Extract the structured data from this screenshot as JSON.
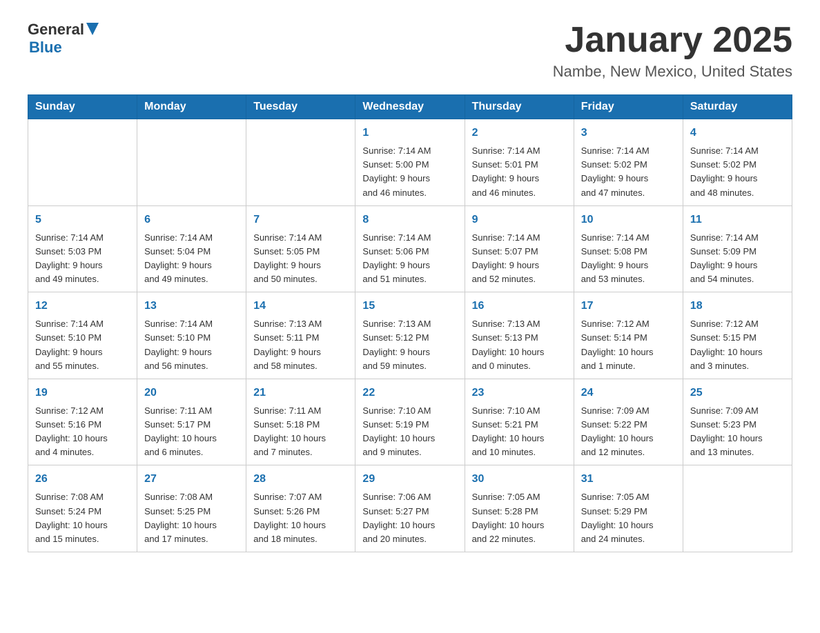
{
  "header": {
    "logo_general": "General",
    "logo_blue": "Blue",
    "title": "January 2025",
    "subtitle": "Nambe, New Mexico, United States"
  },
  "weekdays": [
    "Sunday",
    "Monday",
    "Tuesday",
    "Wednesday",
    "Thursday",
    "Friday",
    "Saturday"
  ],
  "weeks": [
    [
      {
        "day": "",
        "info": ""
      },
      {
        "day": "",
        "info": ""
      },
      {
        "day": "",
        "info": ""
      },
      {
        "day": "1",
        "info": "Sunrise: 7:14 AM\nSunset: 5:00 PM\nDaylight: 9 hours\nand 46 minutes."
      },
      {
        "day": "2",
        "info": "Sunrise: 7:14 AM\nSunset: 5:01 PM\nDaylight: 9 hours\nand 46 minutes."
      },
      {
        "day": "3",
        "info": "Sunrise: 7:14 AM\nSunset: 5:02 PM\nDaylight: 9 hours\nand 47 minutes."
      },
      {
        "day": "4",
        "info": "Sunrise: 7:14 AM\nSunset: 5:02 PM\nDaylight: 9 hours\nand 48 minutes."
      }
    ],
    [
      {
        "day": "5",
        "info": "Sunrise: 7:14 AM\nSunset: 5:03 PM\nDaylight: 9 hours\nand 49 minutes."
      },
      {
        "day": "6",
        "info": "Sunrise: 7:14 AM\nSunset: 5:04 PM\nDaylight: 9 hours\nand 49 minutes."
      },
      {
        "day": "7",
        "info": "Sunrise: 7:14 AM\nSunset: 5:05 PM\nDaylight: 9 hours\nand 50 minutes."
      },
      {
        "day": "8",
        "info": "Sunrise: 7:14 AM\nSunset: 5:06 PM\nDaylight: 9 hours\nand 51 minutes."
      },
      {
        "day": "9",
        "info": "Sunrise: 7:14 AM\nSunset: 5:07 PM\nDaylight: 9 hours\nand 52 minutes."
      },
      {
        "day": "10",
        "info": "Sunrise: 7:14 AM\nSunset: 5:08 PM\nDaylight: 9 hours\nand 53 minutes."
      },
      {
        "day": "11",
        "info": "Sunrise: 7:14 AM\nSunset: 5:09 PM\nDaylight: 9 hours\nand 54 minutes."
      }
    ],
    [
      {
        "day": "12",
        "info": "Sunrise: 7:14 AM\nSunset: 5:10 PM\nDaylight: 9 hours\nand 55 minutes."
      },
      {
        "day": "13",
        "info": "Sunrise: 7:14 AM\nSunset: 5:10 PM\nDaylight: 9 hours\nand 56 minutes."
      },
      {
        "day": "14",
        "info": "Sunrise: 7:13 AM\nSunset: 5:11 PM\nDaylight: 9 hours\nand 58 minutes."
      },
      {
        "day": "15",
        "info": "Sunrise: 7:13 AM\nSunset: 5:12 PM\nDaylight: 9 hours\nand 59 minutes."
      },
      {
        "day": "16",
        "info": "Sunrise: 7:13 AM\nSunset: 5:13 PM\nDaylight: 10 hours\nand 0 minutes."
      },
      {
        "day": "17",
        "info": "Sunrise: 7:12 AM\nSunset: 5:14 PM\nDaylight: 10 hours\nand 1 minute."
      },
      {
        "day": "18",
        "info": "Sunrise: 7:12 AM\nSunset: 5:15 PM\nDaylight: 10 hours\nand 3 minutes."
      }
    ],
    [
      {
        "day": "19",
        "info": "Sunrise: 7:12 AM\nSunset: 5:16 PM\nDaylight: 10 hours\nand 4 minutes."
      },
      {
        "day": "20",
        "info": "Sunrise: 7:11 AM\nSunset: 5:17 PM\nDaylight: 10 hours\nand 6 minutes."
      },
      {
        "day": "21",
        "info": "Sunrise: 7:11 AM\nSunset: 5:18 PM\nDaylight: 10 hours\nand 7 minutes."
      },
      {
        "day": "22",
        "info": "Sunrise: 7:10 AM\nSunset: 5:19 PM\nDaylight: 10 hours\nand 9 minutes."
      },
      {
        "day": "23",
        "info": "Sunrise: 7:10 AM\nSunset: 5:21 PM\nDaylight: 10 hours\nand 10 minutes."
      },
      {
        "day": "24",
        "info": "Sunrise: 7:09 AM\nSunset: 5:22 PM\nDaylight: 10 hours\nand 12 minutes."
      },
      {
        "day": "25",
        "info": "Sunrise: 7:09 AM\nSunset: 5:23 PM\nDaylight: 10 hours\nand 13 minutes."
      }
    ],
    [
      {
        "day": "26",
        "info": "Sunrise: 7:08 AM\nSunset: 5:24 PM\nDaylight: 10 hours\nand 15 minutes."
      },
      {
        "day": "27",
        "info": "Sunrise: 7:08 AM\nSunset: 5:25 PM\nDaylight: 10 hours\nand 17 minutes."
      },
      {
        "day": "28",
        "info": "Sunrise: 7:07 AM\nSunset: 5:26 PM\nDaylight: 10 hours\nand 18 minutes."
      },
      {
        "day": "29",
        "info": "Sunrise: 7:06 AM\nSunset: 5:27 PM\nDaylight: 10 hours\nand 20 minutes."
      },
      {
        "day": "30",
        "info": "Sunrise: 7:05 AM\nSunset: 5:28 PM\nDaylight: 10 hours\nand 22 minutes."
      },
      {
        "day": "31",
        "info": "Sunrise: 7:05 AM\nSunset: 5:29 PM\nDaylight: 10 hours\nand 24 minutes."
      },
      {
        "day": "",
        "info": ""
      }
    ]
  ]
}
